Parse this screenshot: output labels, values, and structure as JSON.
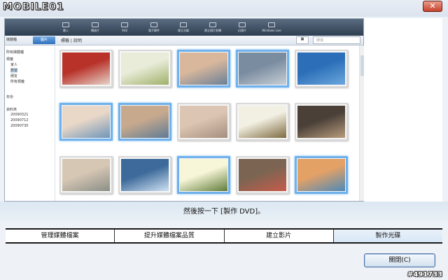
{
  "window": {
    "logo": "MOBILE01",
    "close_glyph": "✕"
  },
  "app": {
    "toolbar": [
      "匯入",
      "播放片",
      "列印",
      "電子郵件",
      "建立光碟",
      "建立相片剪輯",
      "幻燈片",
      "Windows Live"
    ],
    "nav": {
      "library": "媒體櫃",
      "active": "圖片",
      "tags": "標籤 | 說明",
      "search_placeholder": "搜尋"
    },
    "sidebar": [
      {
        "label": "所有媒體櫃",
        "sub": false,
        "sel": false
      },
      {
        "label": "標籤",
        "sub": false,
        "sel": false
      },
      {
        "label": "家人",
        "sub": true,
        "sel": false
      },
      {
        "label": "旅遊",
        "sub": true,
        "sel": true
      },
      {
        "label": "朋友",
        "sub": true,
        "sel": false
      },
      {
        "label": "所有標籤",
        "sub": true,
        "sel": false
      },
      {
        "label": "年份",
        "sub": false,
        "sel": false
      },
      {
        "label": "資料夾",
        "sub": false,
        "sel": false
      },
      {
        "label": "20090321",
        "sub": true,
        "sel": false
      },
      {
        "label": "20090712",
        "sub": true,
        "sel": false
      },
      {
        "label": "20090730",
        "sub": true,
        "sel": false
      }
    ],
    "thumbnails": [
      {
        "name": "strawberries",
        "sel": false,
        "colors": [
          "#b8322a",
          "#e6d3c8"
        ]
      },
      {
        "name": "flowers",
        "sel": false,
        "colors": [
          "#e9ecd9",
          "#9fb06a"
        ]
      },
      {
        "name": "couple-1",
        "sel": true,
        "colors": [
          "#d8b79c",
          "#6b7f96"
        ]
      },
      {
        "name": "wedding-arch",
        "sel": true,
        "colors": [
          "#7a8ca0",
          "#c7cfd6"
        ]
      },
      {
        "name": "palm-tree",
        "sel": false,
        "colors": [
          "#2c6fb8",
          "#6ba7dd"
        ]
      },
      {
        "name": "bride-groom",
        "sel": true,
        "colors": [
          "#e9d7c8",
          "#6f95b8"
        ]
      },
      {
        "name": "couple-2",
        "sel": true,
        "colors": [
          "#c7a98d",
          "#5e7a94"
        ]
      },
      {
        "name": "bride-child",
        "sel": false,
        "colors": [
          "#dcc5b2",
          "#a58e7e"
        ]
      },
      {
        "name": "bouquet",
        "sel": false,
        "colors": [
          "#f2f0e2",
          "#7e6a40"
        ]
      },
      {
        "name": "filmstrip",
        "sel": false,
        "colors": [
          "#4a4038",
          "#b89c7c"
        ]
      },
      {
        "name": "bridesmaids",
        "sel": false,
        "colors": [
          "#d6c6b4",
          "#8a8f86"
        ]
      },
      {
        "name": "sunset",
        "sel": false,
        "colors": [
          "#3d6a9a",
          "#cfe2f3"
        ]
      },
      {
        "name": "daisy",
        "sel": true,
        "colors": [
          "#f8f6d8",
          "#5f7c3a"
        ]
      },
      {
        "name": "dinner",
        "sel": false,
        "colors": [
          "#7b6552",
          "#c75b4a"
        ]
      },
      {
        "name": "feast",
        "sel": true,
        "colors": [
          "#e3a166",
          "#4c89b8"
        ]
      }
    ]
  },
  "caption": "然後按一下 [製作 DVD]。",
  "tabs": [
    {
      "label": "管理媒體檔案",
      "active": false
    },
    {
      "label": "提升媒體檔案品質",
      "active": false
    },
    {
      "label": "建立影片",
      "active": false
    },
    {
      "label": "製作光碟",
      "active": true
    }
  ],
  "close_button": "關閉(C)",
  "watermark": "#491733"
}
